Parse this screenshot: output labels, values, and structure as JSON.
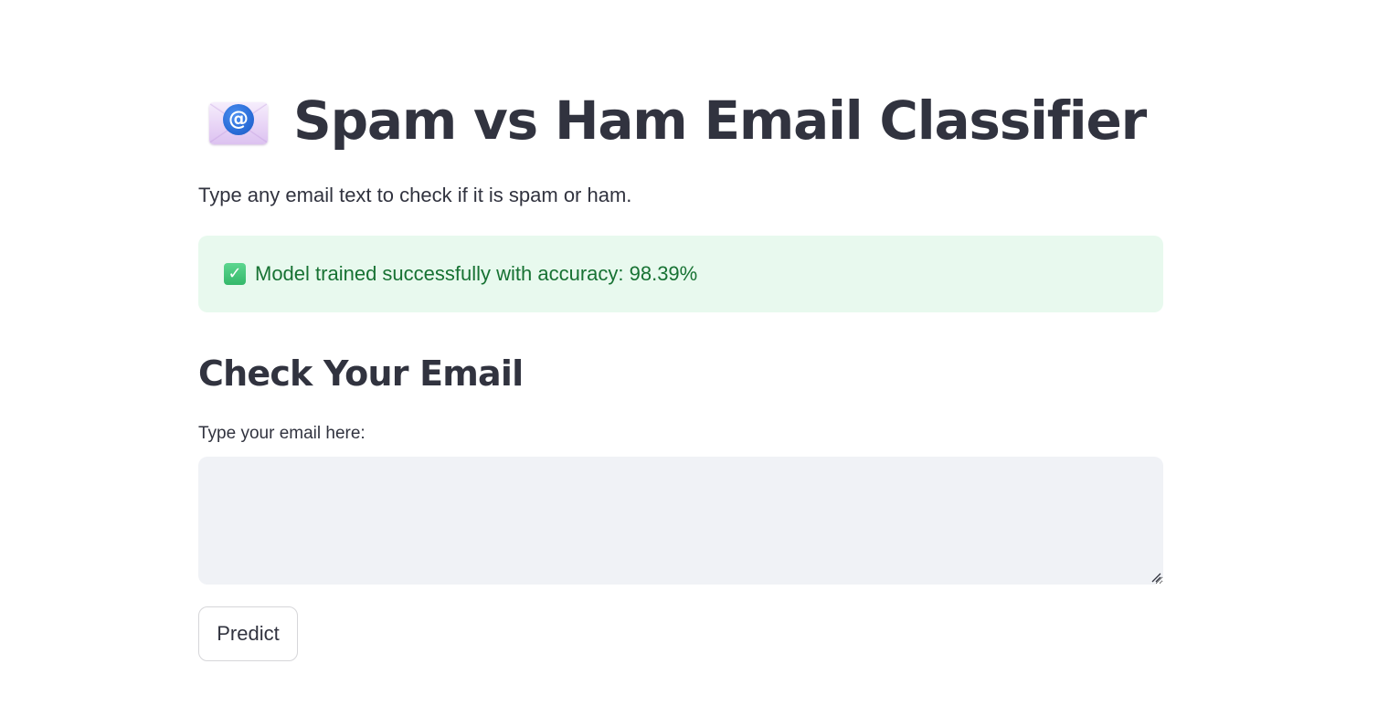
{
  "header": {
    "icon": "envelope-with-at-sign-icon",
    "title": "Spam vs Ham Email Classifier"
  },
  "subtitle": "Type any email text to check if it is spam or ham.",
  "status": {
    "icon": "check-mark-button-icon",
    "message": "Model trained successfully with accuracy: 98.39%",
    "background": "#e8f9ee",
    "text_color": "#177233"
  },
  "check_section": {
    "heading": "Check Your Email",
    "input_label": "Type your email here:",
    "input_value": "",
    "input_placeholder": "",
    "button_label": "Predict"
  },
  "theme": {
    "text": "#31333f",
    "input_background": "#f0f2f6",
    "accent_icon_blue": "#2a6dd8"
  }
}
